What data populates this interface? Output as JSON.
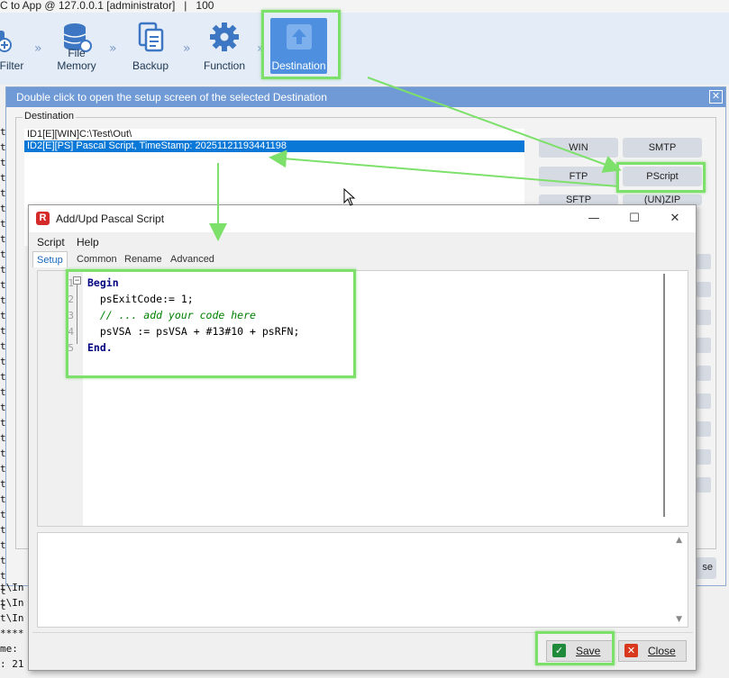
{
  "topbar": {
    "text": "C to App @ 127.0.0.1 [administrator]   |   100"
  },
  "toolbar": {
    "items": [
      {
        "label": "Filter",
        "icon": "filter-add-icon"
      },
      {
        "label": "File Memory",
        "icon": "database-icon"
      },
      {
        "label": "Backup",
        "icon": "copy-icon"
      },
      {
        "label": "Function",
        "icon": "gear-icon"
      },
      {
        "label": "Destination",
        "icon": "upload-icon"
      }
    ]
  },
  "console": {
    "lines_top": [
      "t",
      "t",
      "t",
      "t",
      "t",
      "t",
      "t",
      "t",
      "t",
      "t",
      "t",
      "t",
      "t",
      "t",
      "t",
      "t",
      "t",
      "t",
      "t",
      "t",
      "t",
      "t",
      "t",
      "t",
      "t",
      "t",
      "t",
      "t",
      "t",
      "t",
      "t",
      "t"
    ],
    "lines_bottom": [
      "t\\In",
      "t\\In",
      "t\\In",
      "****",
      "me:",
      ": 21"
    ]
  },
  "setup": {
    "title": "Double click to open the setup screen of the selected Destination",
    "group_label": "Destination",
    "list": [
      "ID1[E][WIN]C:\\Test\\Out\\",
      "ID2[E][PS] Pascal Script, TimeStamp: 20251121193441198"
    ],
    "buttons": {
      "win": "WIN",
      "smtp": "SMTP",
      "ftp": "FTP",
      "pscript": "PScript",
      "sftp": "SFTP",
      "unzip": "(UN)ZIP",
      "close_partial": "se"
    }
  },
  "dialog": {
    "title": "Add/Upd Pascal Script",
    "logo": "R",
    "menu": [
      "Script",
      "Help"
    ],
    "tabs": [
      "Setup",
      "Common",
      "Rename",
      "Advanced"
    ],
    "active_tab": "Setup",
    "code_lines": [
      {
        "n": "1",
        "text": "Begin"
      },
      {
        "n": "2",
        "text": "  psExitCode:= 1;"
      },
      {
        "n": "3",
        "text": "  // ... add your code here"
      },
      {
        "n": "4",
        "text": "  psVSA := psVSA + #13#10 + psRFN;"
      },
      {
        "n": "5",
        "text": "End."
      }
    ],
    "save_label": "Save",
    "close_label": "Close"
  },
  "colors": {
    "accent": "#4e8fe0",
    "highlight": "#7ce06a",
    "selection": "#0a78d7"
  }
}
